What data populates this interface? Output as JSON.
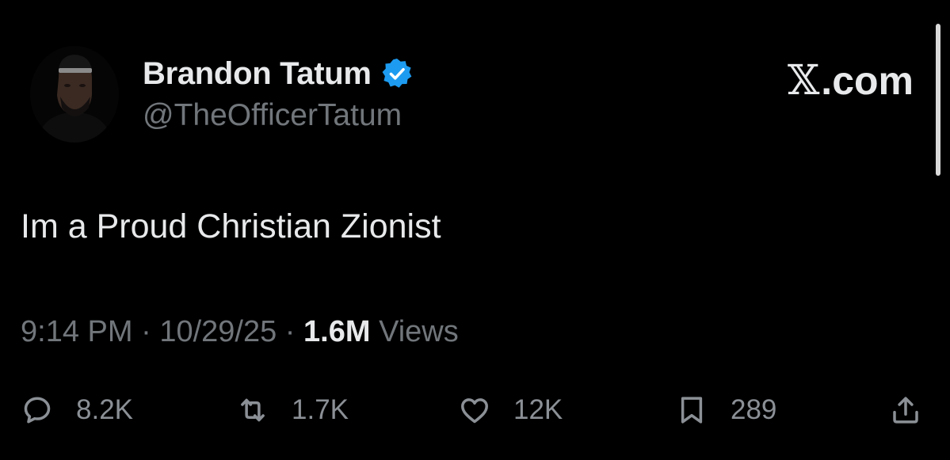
{
  "header": {
    "display_name": "Brandon Tatum",
    "handle": "@TheOfficerTatum",
    "verified_icon": "verified-badge-icon",
    "brand": {
      "mark": "𝕏",
      "text": ".com"
    }
  },
  "tweet": {
    "text": "Im a Proud Christian Zionist",
    "time": "9:14 PM",
    "date": "10/29/25",
    "views_count": "1.6M",
    "views_label": "Views",
    "separator": "·"
  },
  "actions": {
    "replies": {
      "icon": "reply-icon",
      "count": "8.2K"
    },
    "reposts": {
      "icon": "repost-icon",
      "count": "1.7K"
    },
    "likes": {
      "icon": "heart-icon",
      "count": "12K"
    },
    "bookmarks": {
      "icon": "bookmark-icon",
      "count": "289"
    },
    "share": {
      "icon": "share-icon"
    }
  },
  "colors": {
    "background": "#000000",
    "primary_text": "#e7e9ea",
    "secondary_text": "#71767b",
    "verified_blue": "#1d9bf0"
  }
}
